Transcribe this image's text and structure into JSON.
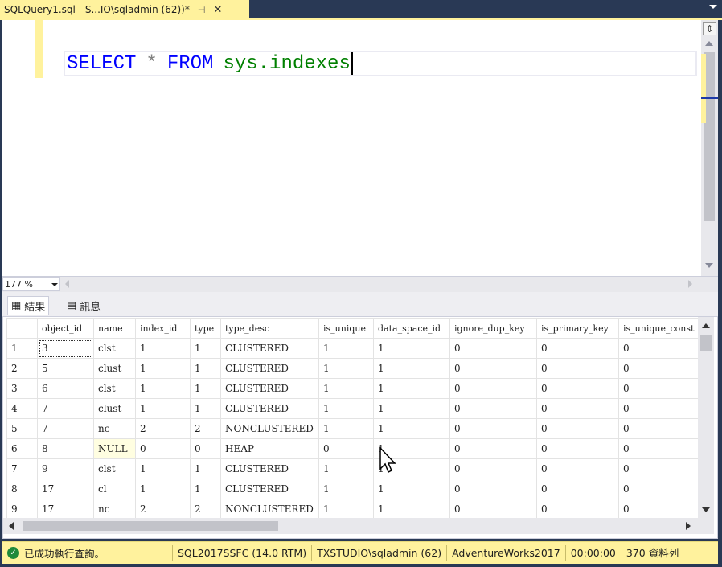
{
  "tab": {
    "title": "SQLQuery1.sql - S...IO\\sqladmin (62))*",
    "pin_icon": "pin-icon",
    "close_icon": "close-icon"
  },
  "editor": {
    "keyword_select": "SELECT",
    "star": "*",
    "keyword_from": "FROM",
    "object": "sys.indexes",
    "zoom": "177 %"
  },
  "result_tabs": {
    "results_label": "結果",
    "messages_label": "訊息"
  },
  "grid": {
    "columns": [
      "",
      "object_id",
      "name",
      "index_id",
      "type",
      "type_desc",
      "is_unique",
      "data_space_id",
      "ignore_dup_key",
      "is_primary_key",
      "is_unique_const"
    ],
    "rows": [
      [
        "1",
        "3",
        "clst",
        "1",
        "1",
        "CLUSTERED",
        "1",
        "1",
        "0",
        "0",
        "0"
      ],
      [
        "2",
        "5",
        "clust",
        "1",
        "1",
        "CLUSTERED",
        "1",
        "1",
        "0",
        "0",
        "0"
      ],
      [
        "3",
        "6",
        "clst",
        "1",
        "1",
        "CLUSTERED",
        "1",
        "1",
        "0",
        "0",
        "0"
      ],
      [
        "4",
        "7",
        "clust",
        "1",
        "1",
        "CLUSTERED",
        "1",
        "1",
        "0",
        "0",
        "0"
      ],
      [
        "5",
        "7",
        "nc",
        "2",
        "2",
        "NONCLUSTERED",
        "1",
        "1",
        "0",
        "0",
        "0"
      ],
      [
        "6",
        "8",
        "NULL",
        "0",
        "0",
        "HEAP",
        "0",
        "1",
        "0",
        "0",
        "0"
      ],
      [
        "7",
        "9",
        "clst",
        "1",
        "1",
        "CLUSTERED",
        "1",
        "1",
        "0",
        "0",
        "0"
      ],
      [
        "8",
        "17",
        "cl",
        "1",
        "1",
        "CLUSTERED",
        "1",
        "1",
        "0",
        "0",
        "0"
      ],
      [
        "9",
        "17",
        "nc",
        "2",
        "2",
        "NONCLUSTERED",
        "1",
        "1",
        "0",
        "0",
        "0"
      ]
    ]
  },
  "status": {
    "message": "已成功執行查詢。",
    "server": "SQL2017SSFC (14.0 RTM)",
    "user": "TXSTUDIO\\sqladmin (62)",
    "database": "AdventureWorks2017",
    "elapsed": "00:00:00",
    "rows": "370 資料列"
  },
  "colors": {
    "accent_yellow": "#fff29d",
    "chrome_blue": "#293955",
    "keyword_blue": "#0000ff",
    "object_green": "#008000"
  }
}
